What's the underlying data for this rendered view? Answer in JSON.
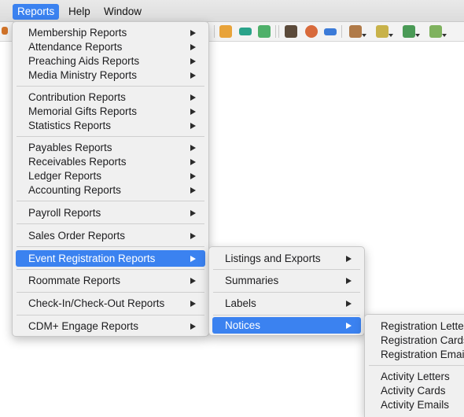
{
  "menubar": {
    "items": [
      {
        "label": "Reports"
      },
      {
        "label": "Help"
      },
      {
        "label": "Window"
      }
    ]
  },
  "reports_menu": {
    "items": [
      {
        "label": "Membership Reports"
      },
      {
        "label": "Attendance Reports"
      },
      {
        "label": "Preaching Aids Reports"
      },
      {
        "label": "Media Ministry Reports"
      },
      {
        "label": "Contribution Reports"
      },
      {
        "label": "Memorial Gifts Reports"
      },
      {
        "label": "Statistics Reports"
      },
      {
        "label": "Payables Reports"
      },
      {
        "label": "Receivables Reports"
      },
      {
        "label": "Ledger Reports"
      },
      {
        "label": "Accounting Reports"
      },
      {
        "label": "Payroll Reports"
      },
      {
        "label": "Sales Order Reports"
      },
      {
        "label": "Event Registration Reports"
      },
      {
        "label": "Roommate Reports"
      },
      {
        "label": "Check-In/Check-Out Reports"
      },
      {
        "label": "CDM+ Engage Reports"
      }
    ]
  },
  "event_submenu": {
    "items": [
      {
        "label": "Listings and Exports"
      },
      {
        "label": "Summaries"
      },
      {
        "label": "Labels"
      },
      {
        "label": "Notices"
      }
    ]
  },
  "notices_submenu": {
    "items": [
      {
        "label": "Registration Letters"
      },
      {
        "label": "Registration Cards"
      },
      {
        "label": "Registration Emails"
      },
      {
        "label": "Activity Letters"
      },
      {
        "label": "Activity Cards"
      },
      {
        "label": "Activity Emails"
      }
    ]
  },
  "colors": {
    "highlight": "#3b82f0",
    "menu_bg": "#f0f0f0"
  }
}
